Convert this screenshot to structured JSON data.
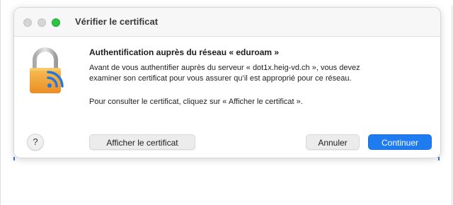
{
  "window": {
    "title": "Vérifier le certificat"
  },
  "dialog": {
    "heading": "Authentification auprès du réseau « eduroam »",
    "body_line1": "Avant de vous authentifier auprès du serveur « dot1x.heig-vd.ch », vous devez",
    "body_line2": "examiner son certificat pour vous assurer qu’il est approprié pour ce réseau.",
    "body_line3": "Pour consulter le certificat, cliquez sur « Afficher le certificat ».",
    "icon": "lock-wifi-icon"
  },
  "buttons": {
    "help_label": "?",
    "show_certificate_label": "Afficher le certificat",
    "cancel_label": "Annuler",
    "continue_label": "Continuer"
  },
  "colors": {
    "accent": "#1f7cf0",
    "lock_gold": "#f0a63a",
    "zoom_green": "#2dc440",
    "wifi_blue": "#2178e0"
  }
}
